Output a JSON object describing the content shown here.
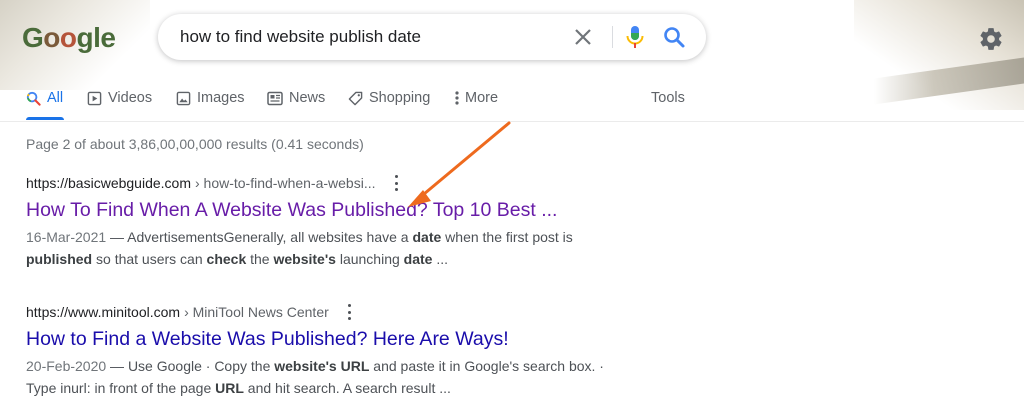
{
  "logo": {
    "letters": [
      "G",
      "o",
      "o",
      "g",
      "l",
      "e"
    ]
  },
  "search": {
    "query": "how to find website publish date"
  },
  "tabs": [
    {
      "label": "All",
      "icon": "search-icon",
      "active": true
    },
    {
      "label": "Videos",
      "icon": "video-icon"
    },
    {
      "label": "Images",
      "icon": "image-icon"
    },
    {
      "label": "News",
      "icon": "news-icon"
    },
    {
      "label": "Shopping",
      "icon": "tag-icon"
    },
    {
      "label": "More",
      "icon": "kebab-icon"
    }
  ],
  "tools_label": "Tools",
  "stats": "Page 2 of about 3,86,00,00,000 results (0.41 seconds)",
  "results": [
    {
      "site": "https://basicwebguide.com",
      "crumb": "› how-to-find-when-a-websi...",
      "title": "How To Find When A Website Was Published? Top 10 Best ...",
      "visited": true,
      "snippet_date": "16-Mar-2021",
      "snippet_line1_pre": " — AdvertisementsGenerally, all websites have a ",
      "snippet_line1_bold": "date",
      "snippet_line1_post": " when the first post is",
      "snippet_line2": [
        {
          "t": "published",
          "b": true
        },
        {
          "t": " so that users can ",
          "b": false
        },
        {
          "t": "check",
          "b": true
        },
        {
          "t": " the ",
          "b": false
        },
        {
          "t": "website's",
          "b": true
        },
        {
          "t": " launching ",
          "b": false
        },
        {
          "t": "date",
          "b": true
        },
        {
          "t": " ...",
          "b": false
        }
      ]
    },
    {
      "site": "https://www.minitool.com",
      "crumb": "› MiniTool News Center",
      "title": "How to Find a Website Was Published? Here Are Ways!",
      "visited": false,
      "snippet_date": "20-Feb-2020",
      "snippet_line1": [
        {
          "t": " — Use Google · Copy the ",
          "b": false
        },
        {
          "t": "website's URL",
          "b": true
        },
        {
          "t": " and paste it in Google's search box. ·",
          "b": false
        }
      ],
      "snippet_line2": [
        {
          "t": "Type inurl: in front of the page ",
          "b": false
        },
        {
          "t": "URL",
          "b": true
        },
        {
          "t": " and hit search. A search result ...",
          "b": false
        }
      ]
    }
  ],
  "colors": {
    "accent": "#1a73e8",
    "visited_link": "#681da8",
    "link": "#1a0dab",
    "annotation_arrow": "#ee6a1e"
  }
}
